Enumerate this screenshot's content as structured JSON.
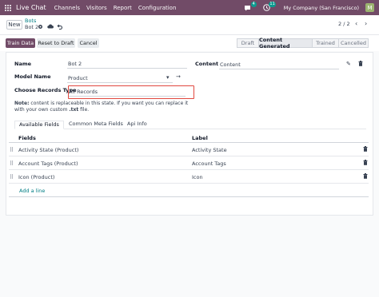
{
  "navbar": {
    "app_name": "Live Chat",
    "menu": [
      "Channels",
      "Visitors",
      "Report",
      "Configuration"
    ],
    "chat_badge": "4",
    "activity_badge": "11",
    "company": "My Company (San Francisco)",
    "avatar_letter": "M",
    "colors": {
      "brand": "#714b67",
      "badge": "#0b9b8f"
    }
  },
  "control": {
    "new_label": "New",
    "breadcrumb_parent": "Bots",
    "breadcrumb_current": "Bot 2",
    "pager": "2 / 2"
  },
  "actions": {
    "train_label": "Train Data",
    "reset_label": "Reset to Draft",
    "cancel_label": "Cancel"
  },
  "statusbar": {
    "stages": [
      "Draft",
      "Content Generated",
      "Trained",
      "Cancelled"
    ],
    "active": "Content Generated"
  },
  "form": {
    "name_label": "Name",
    "name_value": "Bot 2",
    "model_label": "Model Name",
    "model_value": "Product",
    "records_label": "Choose Records Type",
    "records_value": "All Records",
    "content_label": "Content",
    "content_value": "Content",
    "note_bold": "Note:",
    "note_text": " content is replaceable in this state. If you want you can replace it with your own custom ",
    "note_ext": ".txt",
    "note_end": " file.",
    "highlight_color": "#e0483f"
  },
  "tabs": [
    "Available Fields",
    "Common Meta Fields",
    "Api Info"
  ],
  "table": {
    "col_fields": "Fields",
    "col_label": "Label",
    "rows": [
      {
        "field": "Activity State (Product)",
        "label": "Activity State"
      },
      {
        "field": "Account Tags (Product)",
        "label": "Account Tags"
      },
      {
        "field": "Icon (Product)",
        "label": "Icon"
      }
    ],
    "add_line": "Add a line"
  }
}
